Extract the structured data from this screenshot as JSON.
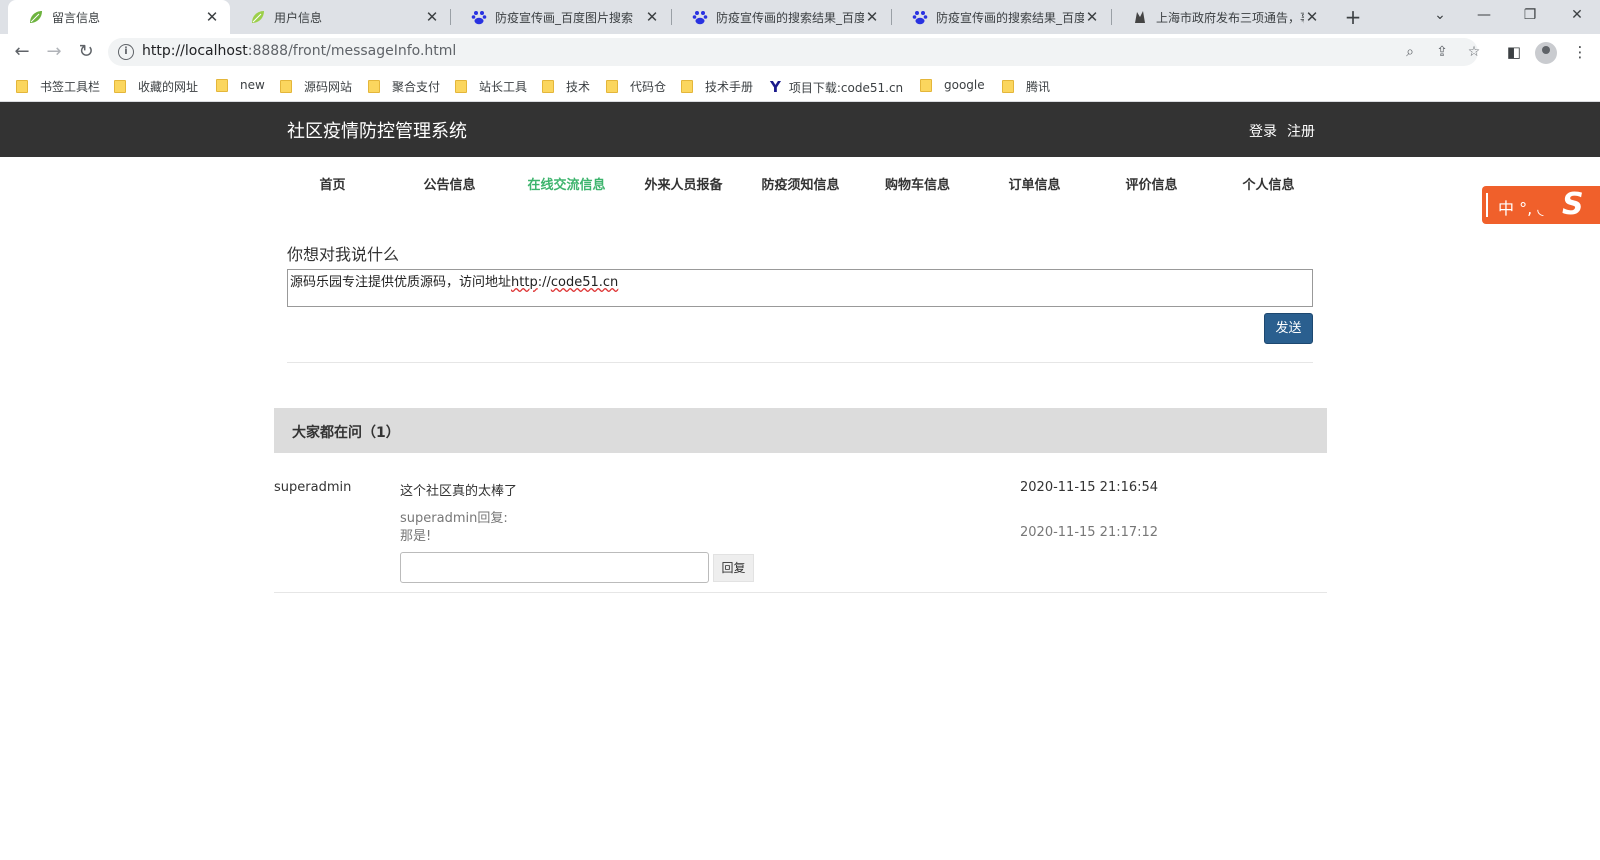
{
  "browser": {
    "tabs": [
      {
        "title": "留言信息",
        "icon": "leaf-icon",
        "active": true
      },
      {
        "title": "用户信息",
        "icon": "leaf-icon",
        "active": false
      },
      {
        "title": "防疫宣传画_百度图片搜索",
        "icon": "baidu-icon",
        "active": false
      },
      {
        "title": "防疫宣传画的搜索结果_百度",
        "icon": "baidu-icon",
        "active": false
      },
      {
        "title": "防疫宣传画的搜索结果_百度",
        "icon": "baidu-icon",
        "active": false
      },
      {
        "title": "上海市政府发布三项通告，事",
        "icon": "gov-icon",
        "active": false
      }
    ],
    "url_host": "http://localhost",
    "url_rest": ":8888/front/messageInfo.html",
    "bookmarks": [
      {
        "label": "书签工具栏",
        "icon": "folder-icon"
      },
      {
        "label": "收藏的网址",
        "icon": "folder-icon"
      },
      {
        "label": "new",
        "icon": "folder-icon"
      },
      {
        "label": "源码网站",
        "icon": "folder-icon"
      },
      {
        "label": "聚合支付",
        "icon": "folder-icon"
      },
      {
        "label": "站长工具",
        "icon": "folder-icon"
      },
      {
        "label": "技术",
        "icon": "folder-icon"
      },
      {
        "label": "代码仓",
        "icon": "folder-icon"
      },
      {
        "label": "技术手册",
        "icon": "folder-icon"
      },
      {
        "label": "项目下载:code51.cn",
        "icon": "y-logo-icon"
      },
      {
        "label": "google",
        "icon": "folder-icon"
      },
      {
        "label": "腾讯",
        "icon": "folder-icon"
      }
    ]
  },
  "site": {
    "title": "社区疫情防控管理系统",
    "login": "登录",
    "register": "注册",
    "nav": [
      {
        "label": "首页",
        "active": false
      },
      {
        "label": "公告信息",
        "active": false
      },
      {
        "label": "在线交流信息",
        "active": true
      },
      {
        "label": "外来人员报备",
        "active": false
      },
      {
        "label": "防疫须知信息",
        "active": false
      },
      {
        "label": "购物车信息",
        "active": false
      },
      {
        "label": "订单信息",
        "active": false
      },
      {
        "label": "评价信息",
        "active": false
      },
      {
        "label": "个人信息",
        "active": false
      }
    ],
    "accent_color": "#3db46d"
  },
  "ime": {
    "text": "中 °, ◟"
  },
  "compose": {
    "label": "你想对我说什么",
    "value_prefix": "源码乐园专注提供优质源码，访问地址",
    "value_link_a": "http",
    "value_link_b": "://",
    "value_link_c": "code51.cn",
    "send_label": "发送"
  },
  "messages": {
    "header": "大家都在问（1）",
    "items": [
      {
        "user": "superadmin",
        "content": "这个社区真的太棒了",
        "time": "2020-11-15 21:16:54",
        "reply_who": "superadmin回复:",
        "reply_text": "那是!",
        "reply_time": "2020-11-15 21:17:12",
        "reply_button": "回复"
      }
    ]
  }
}
